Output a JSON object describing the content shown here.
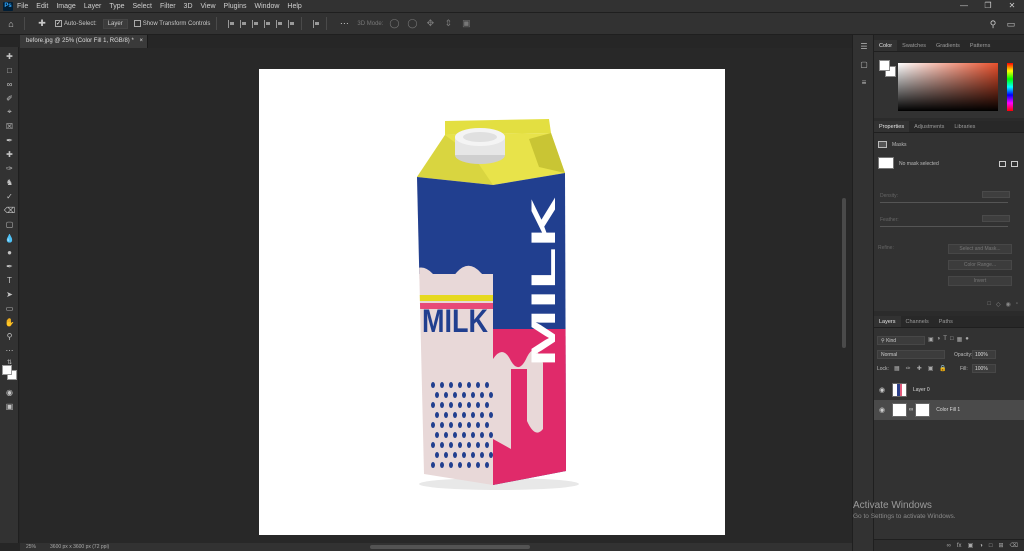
{
  "menubar": {
    "app_logo": "Ps",
    "items": [
      "File",
      "Edit",
      "Image",
      "Layer",
      "Type",
      "Select",
      "Filter",
      "3D",
      "View",
      "Plugins",
      "Window",
      "Help"
    ]
  },
  "options_bar": {
    "auto_select_label": "Auto-Select:",
    "auto_select_value": "Layer",
    "show_transform_label": "Show Transform Controls",
    "mode_3d_label": "3D Mode:"
  },
  "document_tab": {
    "title": "before.jpg @ 25% (Color Fill 1, RGB/8) *",
    "close": "×"
  },
  "status": {
    "zoom": "25%",
    "doc_info": "3600 px x 3600 px (72 ppi)"
  },
  "color_panel": {
    "tabs": [
      "Color",
      "Swatches",
      "Gradients",
      "Patterns"
    ],
    "fg_color": "#ffffff",
    "bg_color": "#ffffff"
  },
  "properties_panel": {
    "tabs": [
      "Properties",
      "Adjustments",
      "Libraries"
    ],
    "section": "Masks",
    "no_mask": "No mask selected",
    "density_label": "Density:",
    "feather_label": "Feather:",
    "refine_label": "Refine:",
    "select_mask_btn": "Select and Mask...",
    "color_range_btn": "Color Range...",
    "invert_btn": "Invert"
  },
  "layers_panel": {
    "tabs": [
      "Layers",
      "Channels",
      "Paths"
    ],
    "filter_kind": "Kind",
    "blend_mode": "Normal",
    "opacity_label": "Opacity:",
    "opacity_value": "100%",
    "lock_label": "Lock:",
    "fill_label": "Fill:",
    "fill_value": "100%",
    "layers": [
      {
        "name": "Layer 0"
      },
      {
        "name": "Color Fill 1"
      }
    ]
  },
  "watermark": {
    "title": "Activate Windows",
    "subtitle": "Go to Settings to activate Windows."
  },
  "carton": {
    "front_text": "MILK",
    "side_text": "MILK"
  }
}
